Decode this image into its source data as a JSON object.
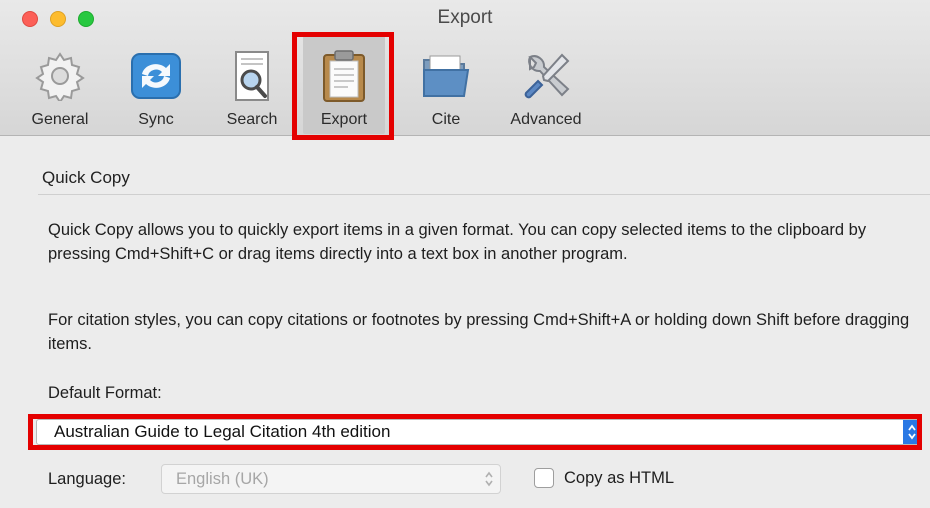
{
  "window": {
    "title": "Export"
  },
  "toolbar": {
    "items": [
      {
        "label": "General",
        "icon": "gear-icon"
      },
      {
        "label": "Sync",
        "icon": "sync-icon"
      },
      {
        "label": "Search",
        "icon": "search-icon"
      },
      {
        "label": "Export",
        "icon": "clipboard-icon",
        "selected": true
      },
      {
        "label": "Cite",
        "icon": "folder-icon"
      },
      {
        "label": "Advanced",
        "icon": "tools-icon"
      }
    ]
  },
  "quick_copy": {
    "title": "Quick Copy",
    "description1": "Quick Copy allows you to quickly export items in a given format. You can copy selected items to the clipboard by pressing Cmd+Shift+C or drag items directly into a text box in another program.",
    "description2": "For citation styles, you can copy citations or footnotes by pressing Cmd+Shift+A or holding down Shift before dragging items.",
    "default_format_label": "Default Format:",
    "default_format_value": "Australian Guide to Legal Citation 4th edition",
    "language_label": "Language:",
    "language_value": "English (UK)",
    "copy_as_html_label": "Copy as HTML",
    "copy_as_html_checked": false
  },
  "colors": {
    "highlight": "#e40000",
    "accent": "#2a78e4"
  }
}
